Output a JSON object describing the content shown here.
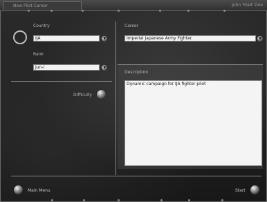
{
  "window": {
    "tab_title": "New Pilot Career",
    "pilot_name": "John 'Mad' Doe"
  },
  "left": {
    "country_label": "Country",
    "country_value": "IJA",
    "rank_label": "Rank",
    "rank_value": "Jun-i",
    "difficulty_label": "Difficulty"
  },
  "right": {
    "career_label": "Career",
    "career_value": "Imperial Japanese Army Fighter.",
    "description_label": "Description",
    "description_text": "Dynamic campaign for IJA fighter pilot"
  },
  "footer": {
    "main_menu_label": "Main Menu",
    "start_label": "Start"
  },
  "icons": {
    "dropdown": "chevron-down-icon",
    "knob": "round-knob-icon"
  },
  "colors": {
    "background": "#1c1d1c",
    "field_bg": "#f2f2f2",
    "frame_line": "#8a8b8a"
  }
}
